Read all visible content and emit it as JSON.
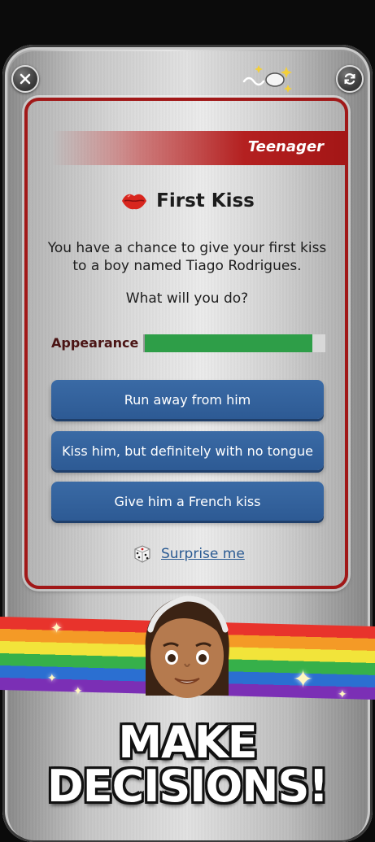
{
  "event": {
    "category": "Teenager",
    "title": "First Kiss",
    "description": "You have a chance to give your first kiss to a boy named Tiago Rodrigues.",
    "question": "What will you do?"
  },
  "stat": {
    "label": "Appearance",
    "level_percent": 93
  },
  "choices": [
    {
      "label": "Run away from him"
    },
    {
      "label": "Kiss him, but definitely with no tongue"
    },
    {
      "label": "Give him a French kiss"
    }
  ],
  "surprise": {
    "label": "Surprise me"
  },
  "promo": {
    "line1": "MAKE",
    "line2": "DECISIONS!"
  },
  "icons": {
    "close": "close-icon",
    "refresh": "refresh-icon",
    "category": "sperm-icon",
    "title": "lips-icon",
    "surprise": "dice-icon"
  },
  "colors": {
    "card_border": "#a11818",
    "choice_button": "#2d5a94",
    "stat_fill": "#2e9e48",
    "link": "#2b5b93"
  }
}
